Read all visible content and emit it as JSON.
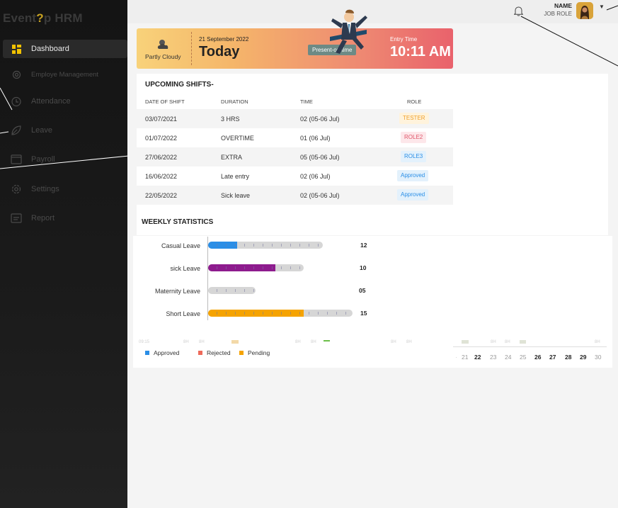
{
  "app": {
    "logo_prefix": "Event",
    "logo_bulb": "?",
    "logo_suffix": "p HRM"
  },
  "sidebar": {
    "items": [
      {
        "label": "Dashboard",
        "icon": "dashboard-grid-icon",
        "active": true
      },
      {
        "label": "Employe Management",
        "icon": "gear-user-icon"
      },
      {
        "label": "Attendance",
        "icon": "clock-icon"
      },
      {
        "label": "Leave",
        "icon": "leaf-icon"
      },
      {
        "label": "Payroll",
        "icon": "wallet-icon"
      },
      {
        "label": "Settings",
        "icon": "gear-icon"
      },
      {
        "label": "Report",
        "icon": "report-icon"
      }
    ]
  },
  "topbar": {
    "user_name": "NAME",
    "user_role": "JOB ROLE"
  },
  "banner": {
    "weather": "Partly Cloudy",
    "date": "21 September 2022",
    "day_label": "Today",
    "status": "Present-on time",
    "entry_label": "Entry Time",
    "entry_time": "10:11 AM"
  },
  "shifts": {
    "title": "UPCOMING SHIFTS-",
    "headers": [
      "DATE OF SHIFT",
      "DURATION",
      "TIME",
      "ROLE"
    ],
    "rows": [
      {
        "date": "03/07/2021",
        "duration": "3 HRS",
        "time": "02 (05-06 Jul)",
        "role": "TESTER"
      },
      {
        "date": "01/07/2022",
        "duration": "OVERTIME",
        "time": "01 (06 Jul)",
        "role": "ROLE2"
      },
      {
        "date": "27/06/2022",
        "duration": "EXTRA",
        "time": "05 (05-06 Jul)",
        "role": "ROLE3"
      },
      {
        "date": "16/06/2022",
        "duration": "Late entry",
        "time": "02 (06 Jul)",
        "role": "Approved"
      },
      {
        "date": "22/05/2022",
        "duration": "Sick leave",
        "time": "02 (05-06 Jul)",
        "role": "Approved"
      }
    ]
  },
  "weekly": {
    "title": "WEEKLY STATISTICS",
    "legend": [
      "Approved",
      "Rejected",
      "Pending"
    ],
    "calendar_days": [
      "21",
      "22",
      "23",
      "24",
      "25",
      "26",
      "27",
      "28",
      "29",
      "30"
    ]
  },
  "chart_data": {
    "type": "bar",
    "title": "WEEKLY STATISTICS",
    "categories": [
      "Casual Leave",
      "sick Leave",
      "Maternity Leave",
      "Short Leave"
    ],
    "values": [
      12,
      10,
      5,
      15
    ],
    "value_labels": [
      "12",
      "10",
      "05",
      "15"
    ],
    "legend": [
      "Approved",
      "Rejected",
      "Pending"
    ],
    "colors": {
      "approved": "#2a8ee6",
      "rejected": "#8e1b8e",
      "pending": "#f5a300",
      "track": "#d6d6d6"
    }
  }
}
